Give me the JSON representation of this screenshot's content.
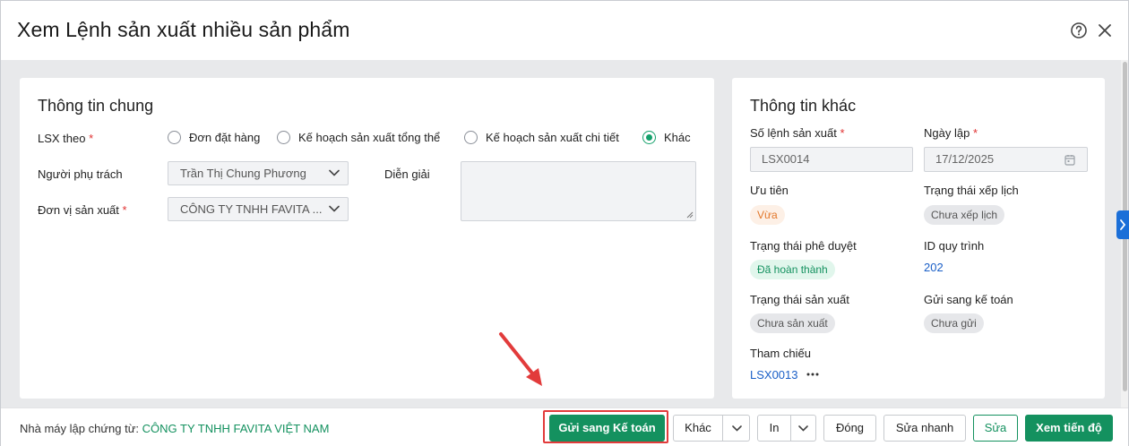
{
  "dialog": {
    "title": "Xem Lệnh sản xuất nhiều sản phẩm",
    "help_icon": "help-circle-icon",
    "close_icon": "close-icon"
  },
  "general": {
    "title": "Thông tin chung",
    "lsx_theo_label": "LSX theo",
    "required_mark": "*",
    "radio_options": [
      "Đơn đặt hàng",
      "Kế hoạch sản xuất tổng thể",
      "Kế hoạch sản xuất chi tiết",
      "Khác"
    ],
    "radio_selected": "Khác",
    "nguoi_phu_trach_label": "Người phụ trách",
    "nguoi_phu_trach_value": "Trần Thị Chung Phương",
    "don_vi_label": "Đơn vị sản xuất",
    "don_vi_value": "CÔNG TY TNHH FAVITA ...",
    "dien_giai_label": "Diễn giải",
    "dien_giai_value": ""
  },
  "other": {
    "title": "Thông tin khác",
    "so_lenh_label": "Số lệnh sản xuất",
    "so_lenh_value": "LSX0014",
    "ngay_lap_label": "Ngày lập",
    "ngay_lap_value": "17/12/2025",
    "uu_tien_label": "Ưu tiên",
    "uu_tien_value": "Vừa",
    "trang_thai_xep_lich_label": "Trạng thái xếp lịch",
    "trang_thai_xep_lich_value": "Chưa xếp lịch",
    "trang_thai_phe_duyet_label": "Trạng thái phê duyệt",
    "trang_thai_phe_duyet_value": "Đã hoàn thành",
    "id_quy_trinh_label": "ID quy trình",
    "id_quy_trinh_value": "202",
    "trang_thai_san_xuat_label": "Trạng thái sản xuất",
    "trang_thai_san_xuat_value": "Chưa sản xuất",
    "gui_ke_toan_label": "Gửi sang kế toán",
    "gui_ke_toan_value": "Chưa gửi",
    "tham_chieu_label": "Tham chiếu",
    "tham_chieu_value": "LSX0013"
  },
  "footer": {
    "factory_label": "Nhà máy lập chứng từ:",
    "factory_value": "CÔNG TY TNHH FAVITA VIỆT NAM",
    "btn_gui_ke_toan": "Gửi sang Kế toán",
    "btn_khac": "Khác",
    "btn_in": "In",
    "btn_dong": "Đóng",
    "btn_sua_nhanh": "Sửa nhanh",
    "btn_sua": "Sửa",
    "btn_xem_tien_do": "Xem tiến độ"
  },
  "colors": {
    "primary_green": "#14915f",
    "highlight_red": "#e23b3b",
    "link_blue": "#1a5fc7"
  }
}
